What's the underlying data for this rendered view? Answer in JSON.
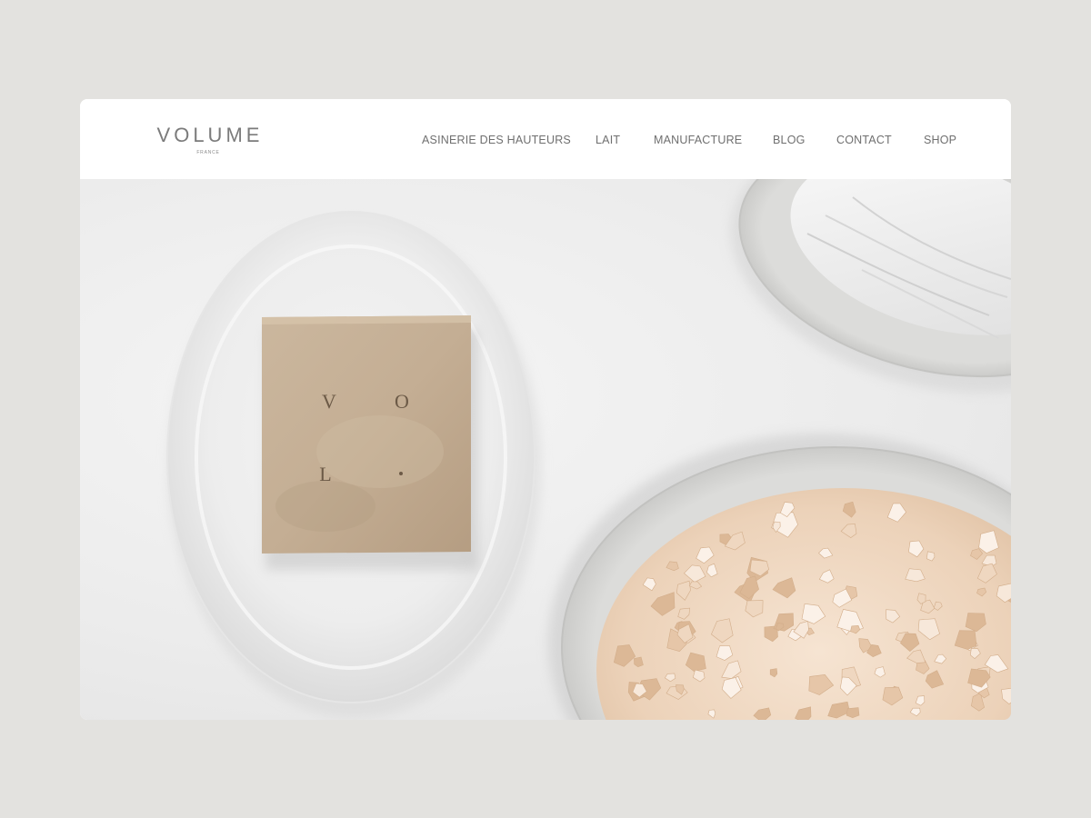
{
  "brand": {
    "name": "VOLUME",
    "subtitle": "FRANCE"
  },
  "nav": {
    "items": [
      {
        "label": "ASINERIE DES HAUTEURS"
      },
      {
        "label": "LAIT"
      },
      {
        "label": "MANUFACTURE"
      },
      {
        "label": "BLOG"
      },
      {
        "label": "CONTACT"
      },
      {
        "label": "SHOP"
      }
    ]
  },
  "hero": {
    "soap_stamp": [
      "V",
      "O",
      "L",
      "."
    ]
  },
  "colors": {
    "page_background": "#e3e2df",
    "header_background": "#ffffff",
    "nav_text": "#6f6f6f",
    "logo_text": "#7b7b7b",
    "soap": "#c2ad93",
    "salt": "#eed6bf"
  }
}
